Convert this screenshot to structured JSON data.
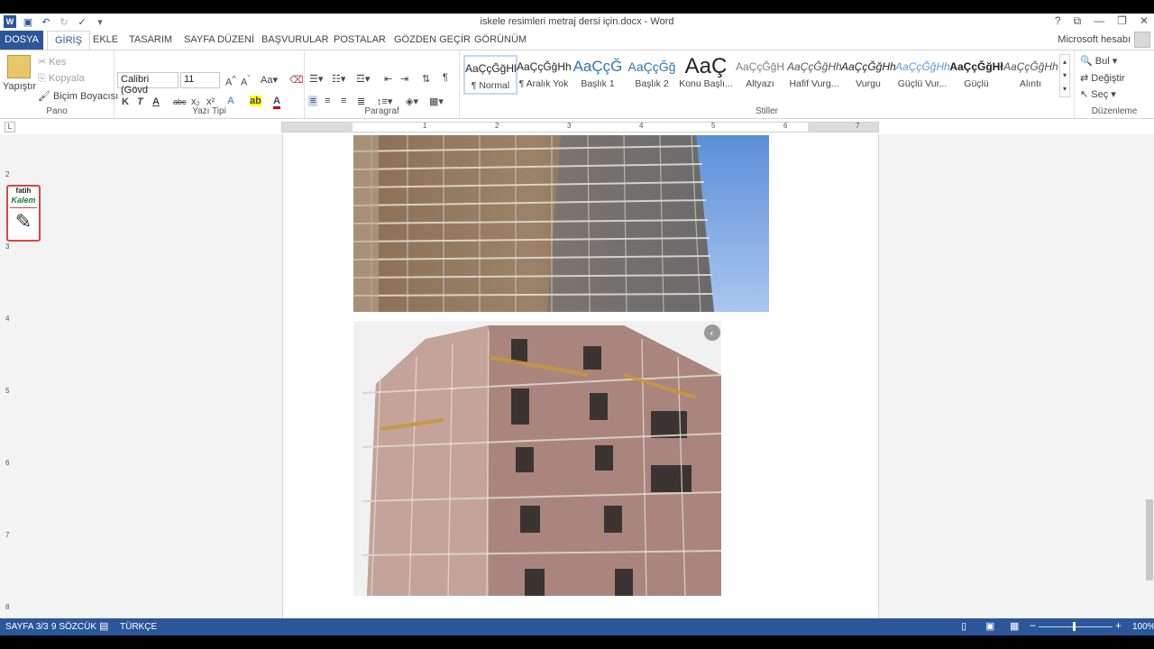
{
  "window": {
    "title": "iskele resimleri metraj dersi için.docx - Word",
    "account": "Microsoft hesabı",
    "controls": [
      "?",
      "⧉",
      "—",
      "❐",
      "✕"
    ]
  },
  "tabs": [
    "DOSYA",
    "GİRİŞ",
    "EKLE",
    "TASARIM",
    "SAYFA DÜZENİ",
    "BAŞVURULAR",
    "POSTALAR",
    "GÖZDEN GEÇİR",
    "GÖRÜNÜM"
  ],
  "ribbon": {
    "clipboard": {
      "paste": "Yapıştır",
      "cut": "Kes",
      "copy": "Kopyala",
      "format_painter": "Biçim Boyacısı",
      "label": "Pano"
    },
    "font": {
      "font_name": "Calibri (Gövd",
      "font_size": "11",
      "label": "Yazı Tipi"
    },
    "paragraph": {
      "label": "Paragraf"
    },
    "styles": {
      "label": "Stiller",
      "items": [
        {
          "sample": "AaÇçĞğHh",
          "name": "¶ Normal"
        },
        {
          "sample": "AaÇçĞğHh",
          "name": "¶ Aralık Yok"
        },
        {
          "sample": "AaÇçĞ",
          "name": "Başlık 1"
        },
        {
          "sample": "AaÇçĞğ",
          "name": "Başlık 2"
        },
        {
          "sample": "AaÇ",
          "name": "Konu Başlı..."
        },
        {
          "sample": "AaÇçĞğH",
          "name": "Altyazı"
        },
        {
          "sample": "AaÇçĞğHh",
          "name": "Hafif Vurg..."
        },
        {
          "sample": "AaÇçĞğHh",
          "name": "Vurgu"
        },
        {
          "sample": "AaÇçĞğHh",
          "name": "Güçlü Vur..."
        },
        {
          "sample": "AaÇçĞğHł",
          "name": "Güçlü"
        },
        {
          "sample": "AaÇçĞğHh",
          "name": "Alıntı"
        }
      ]
    },
    "editing": {
      "find": "Bul",
      "replace": "Değiştir",
      "select": "Seç",
      "label": "Düzenleme"
    }
  },
  "ruler": {
    "ticks": [
      "1",
      "2",
      "3",
      "4",
      "5",
      "6",
      "7"
    ]
  },
  "vruler": {
    "ticks": [
      "2",
      "3",
      "4",
      "5",
      "6",
      "7",
      "8"
    ]
  },
  "overlay": {
    "logo_line1": "fatih",
    "logo_line2": "Kalem"
  },
  "status": {
    "page": "SAYFA 3/3",
    "words": "9 SÖZCÜK",
    "language": "TÜRKÇE",
    "zoom": "100%"
  },
  "colors": {
    "accent": "#2b579a"
  }
}
